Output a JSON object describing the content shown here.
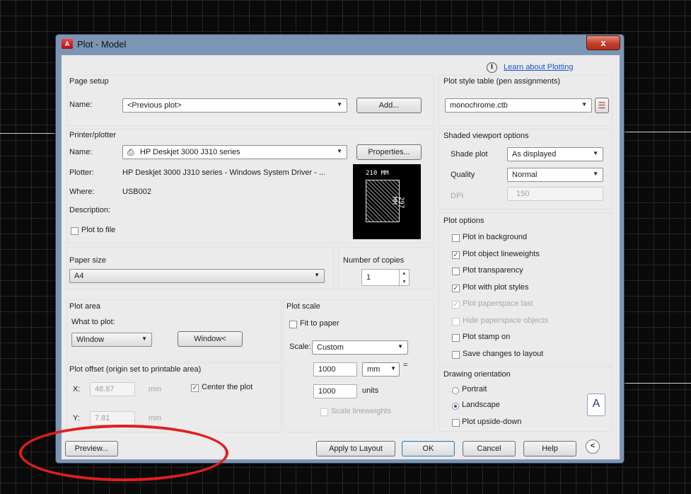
{
  "window": {
    "title": "Plot - Model",
    "close": "x"
  },
  "learn_link": "Learn about Plotting",
  "page_setup": {
    "heading": "Page setup",
    "name_label": "Name:",
    "name_value": "<Previous plot>",
    "add_button": "Add..."
  },
  "printer": {
    "heading": "Printer/plotter",
    "name_label": "Name:",
    "name_value": "HP Deskjet 3000 J310 series",
    "properties_button": "Properties...",
    "plotter_label": "Plotter:",
    "plotter_value": "HP Deskjet 3000 J310 series - Windows System Driver - ...",
    "where_label": "Where:",
    "where_value": "USB002",
    "description_label": "Description:",
    "plot_to_file": "Plot to file",
    "preview_width": "210 MM",
    "preview_height": "297 MM"
  },
  "paper_size": {
    "heading": "Paper size",
    "value": "A4"
  },
  "copies": {
    "heading": "Number of copies",
    "value": "1"
  },
  "plot_area": {
    "heading": "Plot area",
    "what_label": "What to plot:",
    "what_value": "Window",
    "window_button": "Window<"
  },
  "plot_scale": {
    "heading": "Plot scale",
    "fit_to_paper": "Fit to paper",
    "scale_label": "Scale:",
    "scale_value": "Custom",
    "value1": "1000",
    "unit1": "mm",
    "equals": "=",
    "value2": "1000",
    "unit2": "units",
    "scale_lineweights": "Scale lineweights"
  },
  "plot_offset": {
    "heading": "Plot offset (origin set to printable area)",
    "x_label": "X:",
    "x_value": "48.87",
    "x_unit": "mm",
    "y_label": "Y:",
    "y_value": "7.81",
    "y_unit": "mm",
    "center_the_plot": "Center the plot"
  },
  "plot_style_table": {
    "heading": "Plot style table (pen assignments)",
    "value": "monochrome.ctb"
  },
  "shaded": {
    "heading": "Shaded viewport options",
    "shade_label": "Shade plot",
    "shade_value": "As displayed",
    "quality_label": "Quality",
    "quality_value": "Normal",
    "dpi_label": "DPI",
    "dpi_value": "150"
  },
  "plot_options": {
    "heading": "Plot options",
    "items": [
      {
        "label": "Plot in background",
        "checked": false,
        "enabled": true
      },
      {
        "label": "Plot object lineweights",
        "checked": true,
        "enabled": true
      },
      {
        "label": "Plot transparency",
        "checked": false,
        "enabled": true
      },
      {
        "label": "Plot with plot styles",
        "checked": true,
        "enabled": true
      },
      {
        "label": "Plot paperspace last",
        "checked": true,
        "enabled": false
      },
      {
        "label": "Hide paperspace objects",
        "checked": false,
        "enabled": false
      },
      {
        "label": "Plot stamp on",
        "checked": false,
        "enabled": true
      },
      {
        "label": "Save changes to layout",
        "checked": false,
        "enabled": true
      }
    ]
  },
  "orientation": {
    "heading": "Drawing orientation",
    "portrait": "Portrait",
    "landscape": "Landscape",
    "upside_down": "Plot upside-down",
    "selected": "Landscape"
  },
  "footer": {
    "preview": "Preview...",
    "apply": "Apply to Layout",
    "ok": "OK",
    "cancel": "Cancel",
    "help": "Help"
  },
  "icons": [
    "app-icon",
    "close-icon",
    "info-icon",
    "printer-icon",
    "edit-plot-style-icon",
    "spinner-icon",
    "dropdown-arrow-icon",
    "landscape-orientation-icon",
    "collapse-icon"
  ],
  "colors": {
    "annotation": "#e01e1e",
    "titlebar": "#7b95b5",
    "link": "#1a55c8"
  }
}
